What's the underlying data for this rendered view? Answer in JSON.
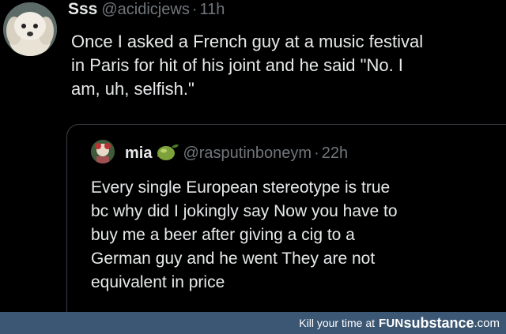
{
  "tweet": {
    "display_name": "Sss",
    "handle": "@acidicjews",
    "separator": "·",
    "time": "11h",
    "text": "Once I asked a French guy at a music festival\nin Paris for hit of his joint and he said \"No. I\nam, uh, selfish.\"",
    "avatar_icon": "white-dog-avatar-icon"
  },
  "quoted_tweet": {
    "display_name": "mia",
    "name_emoji_icon": "olive-emoji-icon",
    "handle": "@rasputinboneym",
    "separator": "·",
    "time": "22h",
    "text": "Every single European stereotype is true\nbc why did I jokingly say Now you have to\nbuy me a beer after giving a cig to a\nGerman guy and he went They are not\nequivalent in price",
    "avatar_icon": "cartoon-avatar-icon"
  },
  "watermark": {
    "prefix": "Kill your time at",
    "brand_fun": "FUN",
    "brand_substance": "substance",
    "brand_tld": ".com",
    "bar_color": "#3c5774"
  },
  "colors": {
    "background": "#000000",
    "text": "#e7e9ea",
    "muted": "#71767b",
    "border": "#3a3f44"
  }
}
